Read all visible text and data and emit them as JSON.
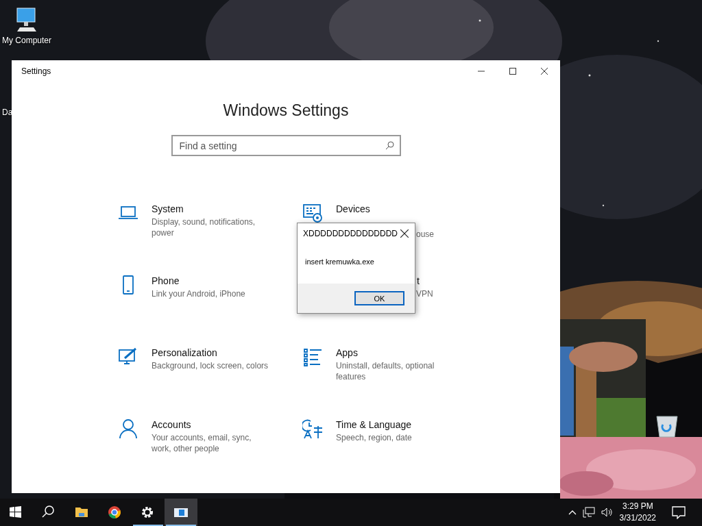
{
  "desktop": {
    "icons": [
      {
        "kind": "computer",
        "label": "My Computer"
      },
      {
        "kind": "hidden",
        "label": "Da"
      },
      {
        "kind": "recycle-bin"
      }
    ]
  },
  "settings_window": {
    "title": "Settings",
    "heading": "Windows Settings",
    "search": {
      "placeholder": "Find a setting"
    },
    "categories": [
      {
        "kind": "system",
        "title": "System",
        "description": "Display, sound, notifications, power"
      },
      {
        "kind": "devices",
        "title": "Devices",
        "description_tail": "ouse"
      },
      {
        "kind": "phone",
        "title": "Phone",
        "description": "Link your Android, iPhone"
      },
      {
        "kind": "network",
        "title_tail": "t",
        "description_tail": "VPN"
      },
      {
        "kind": "personalization",
        "title": "Personalization",
        "description": "Background, lock screen, colors"
      },
      {
        "kind": "apps",
        "title": "Apps",
        "description": "Uninstall, defaults, optional features"
      },
      {
        "kind": "accounts",
        "title": "Accounts",
        "description": "Your accounts, email, sync, work, other people"
      },
      {
        "kind": "time",
        "title": "Time & Language",
        "description": "Speech, region, date"
      }
    ]
  },
  "dialog": {
    "title": "XDDDDDDDDDDDDDDD",
    "message": "insert kremuwka.exe",
    "button": "OK"
  },
  "taskbar": {
    "items": [
      {
        "kind": "start",
        "running": false,
        "selected": false
      },
      {
        "kind": "search",
        "running": false,
        "selected": false
      },
      {
        "kind": "explorer",
        "running": false,
        "selected": false
      },
      {
        "kind": "chrome",
        "running": false,
        "selected": false
      },
      {
        "kind": "gear",
        "running": true,
        "selected": false
      },
      {
        "kind": "app",
        "running": true,
        "selected": true
      }
    ],
    "tray": {
      "time": "3:29 PM",
      "date": "3/31/2022"
    }
  }
}
